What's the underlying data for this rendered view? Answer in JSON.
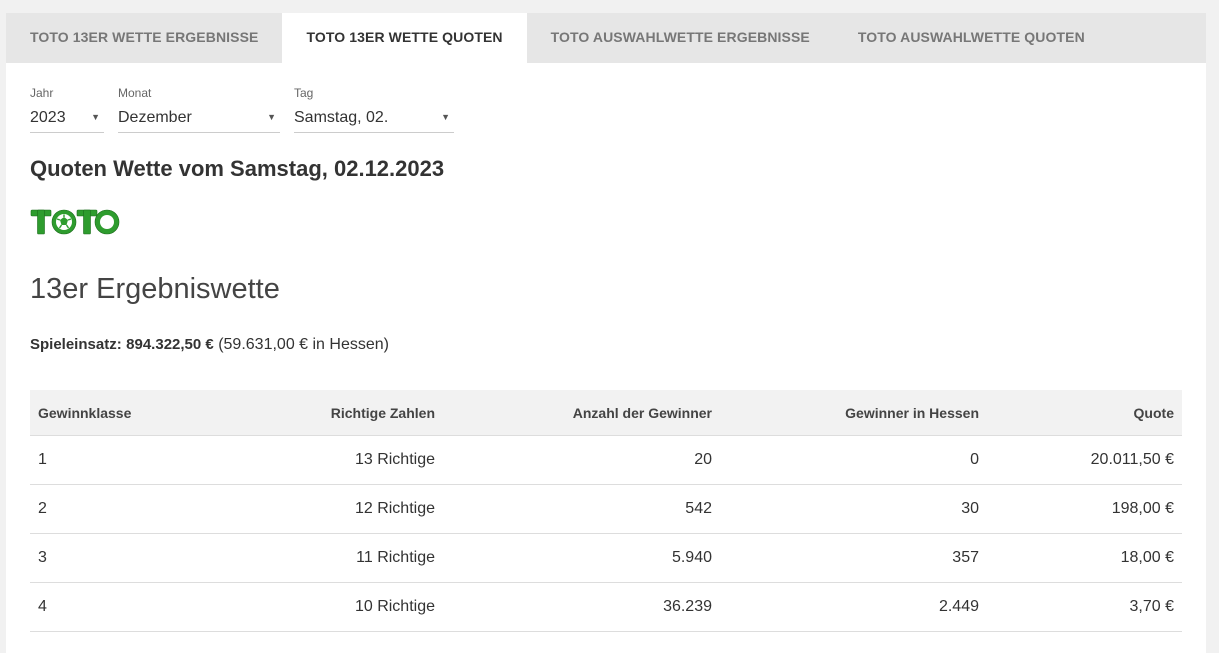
{
  "tabs": [
    {
      "label": "TOTO 13ER WETTE ERGEBNISSE",
      "active": false
    },
    {
      "label": "TOTO 13ER WETTE QUOTEN",
      "active": true
    },
    {
      "label": "TOTO AUSWAHLWETTE ERGEBNISSE",
      "active": false
    },
    {
      "label": "TOTO AUSWAHLWETTE QUOTEN",
      "active": false
    }
  ],
  "filters": {
    "year": {
      "label": "Jahr",
      "value": "2023"
    },
    "month": {
      "label": "Monat",
      "value": "Dezember"
    },
    "day": {
      "label": "Tag",
      "value": "Samstag, 02."
    }
  },
  "title": "Quoten Wette vom Samstag, 02.12.2023",
  "logo": {
    "text": "TOTO",
    "color": "#2e9c2e"
  },
  "subtitle": "13er Ergebniswette",
  "stake": {
    "label": "Spieleinsatz:",
    "amount": "894.322,50  €",
    "hessen": "(59.631,00  € in Hessen)"
  },
  "table": {
    "headers": [
      "Gewinnklasse",
      "Richtige Zahlen",
      "Anzahl der Gewinner",
      "Gewinner in Hessen",
      "Quote"
    ],
    "rows": [
      [
        "1",
        "13 Richtige",
        "20",
        "0",
        "20.011,50  €"
      ],
      [
        "2",
        "12 Richtige",
        "542",
        "30",
        "198,00  €"
      ],
      [
        "3",
        "11 Richtige",
        "5.940",
        "357",
        "18,00  €"
      ],
      [
        "4",
        "10 Richtige",
        "36.239",
        "2.449",
        "3,70  €"
      ]
    ]
  },
  "colors": {
    "brand_green": "#2e9c2e",
    "tab_bar": "#e6e6e6"
  }
}
